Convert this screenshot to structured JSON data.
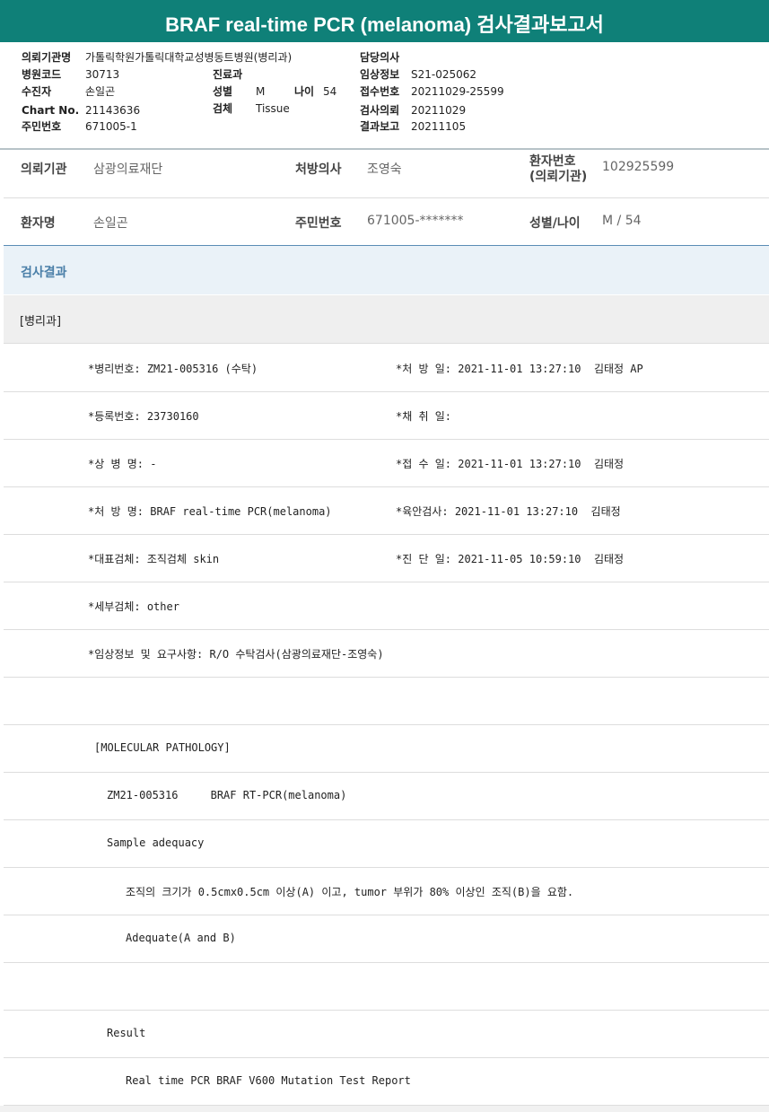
{
  "title": "BRAF real-time PCR (melanoma) 검사결과보고서",
  "header": {
    "institution_label": "의뢰기관명",
    "institution_value": "가톨릭학원가톨릭대학교성병동트병원(병리과)",
    "hospital_code_label": "병원코드",
    "hospital_code_value": "30713",
    "patient_label": "수진자",
    "patient_value": "손일곤",
    "chart_label": "Chart No.",
    "chart_value": "21143636",
    "rrn_label": "주민번호",
    "rrn_value": "671005-1",
    "dept_label": "진료과",
    "sex_label": "성별",
    "sex_value": "M",
    "age_label": "나이",
    "age_value": "54",
    "specimen_label": "검체",
    "specimen_value": "Tissue",
    "doctor_label": "담당의사",
    "clinical_label": "임상정보",
    "clinical_value": "S21-025062",
    "receipt_label": "접수번호",
    "receipt_value": "20211029-25599",
    "request_label": "검사의뢰",
    "request_value": "20211029",
    "report_label": "결과보고",
    "report_value": "20211105"
  },
  "info": {
    "req_inst_label": "의뢰기관",
    "req_inst_value": "삼광의료재단",
    "prescriber_label": "처방의사",
    "prescriber_value": "조영숙",
    "patient_no_label_1": "환자번호",
    "patient_no_label_2": "(의뢰기관)",
    "patient_no_value": "102925599",
    "name_label": "환자명",
    "name_value": "손일곤",
    "rrn_label": "주민번호",
    "rrn_value": "671005-*******",
    "sexage_label": "성별/나이",
    "sexage_value": "M / 54"
  },
  "result_section": "검사결과",
  "department": "[병리과]",
  "rows": [
    {
      "left": "*병리번호: ZM21-005316 (수탁)",
      "right": "*처 방 일: 2021-11-01 13:27:10  김태정 AP"
    },
    {
      "left": "*등록번호: 23730160",
      "right": "*채 취 일:"
    },
    {
      "left": "*상 병 명: -",
      "right": "*접 수 일: 2021-11-01 13:27:10  김태정"
    },
    {
      "left": "*처 방 명: BRAF real-time PCR(melanoma)",
      "right": "*육안검사: 2021-11-01 13:27:10  김태정"
    },
    {
      "left": "*대표검체: 조직검체 skin",
      "right": "*진 단 일: 2021-11-05 10:59:10  김태정"
    },
    {
      "left": "*세부검체: other",
      "right": ""
    },
    {
      "left": "*임상정보 및 요구사항: R/O 수탁검사(삼광의료재단-조영숙)",
      "right": ""
    }
  ],
  "report_lines": [
    "",
    "[MOLECULAR PATHOLOGY]",
    "ZM21-005316     BRAF RT-PCR(melanoma)",
    "Sample adequacy",
    "조직의 크기가 0.5cmx0.5cm 이상(A) 이고, tumor 부위가 80% 이상인 조직(B)을 요함.",
    "Adequate(A and B)",
    "",
    "Result",
    "Real time PCR BRAF V600 Mutation Test Report"
  ]
}
